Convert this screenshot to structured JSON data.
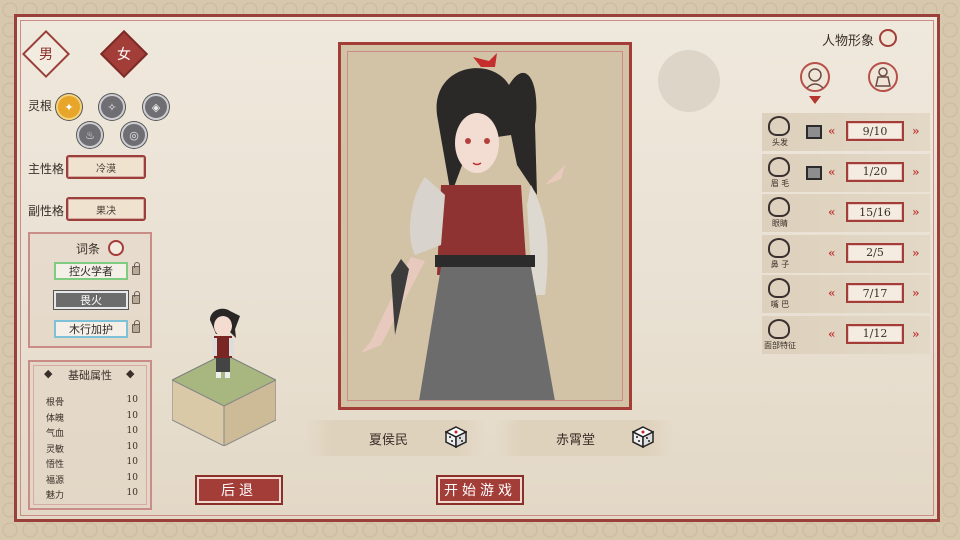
{
  "gender": {
    "male": "男",
    "female": "女",
    "selected": "female"
  },
  "spirit_root": {
    "label": "灵根",
    "roots": [
      {
        "icon": "water-element-icon",
        "active": true
      },
      {
        "icon": "wood-element-icon",
        "active": false
      },
      {
        "icon": "metal-element-icon",
        "active": false
      },
      {
        "icon": "fire-element-icon",
        "active": false
      },
      {
        "icon": "earth-element-icon",
        "active": false
      }
    ]
  },
  "personality": {
    "main_label": "主性格",
    "main_value": "冷漠",
    "sub_label": "副性格",
    "sub_value": "果决"
  },
  "traits": {
    "title": "词条",
    "items": [
      "控火学者",
      "畏火",
      "木行加护"
    ]
  },
  "attributes": {
    "title": "基础属性",
    "rows": [
      {
        "name": "根骨",
        "value": "10"
      },
      {
        "name": "体魄",
        "value": "10"
      },
      {
        "name": "气血",
        "value": "10"
      },
      {
        "name": "灵敏",
        "value": "10"
      },
      {
        "name": "悟性",
        "value": "10"
      },
      {
        "name": "福源",
        "value": "10"
      },
      {
        "name": "魅力",
        "value": "10"
      }
    ]
  },
  "names": {
    "surname": "夏侯民",
    "given": "赤霄堂"
  },
  "buttons": {
    "back": "后退",
    "start": "开始游戏"
  },
  "appearance": {
    "title": "人物形象",
    "features": [
      {
        "label": "头发",
        "value": "9/10",
        "has_color": true
      },
      {
        "label": "眉 毛",
        "value": "1/20",
        "has_color": true
      },
      {
        "label": "眼睛",
        "value": "15/16",
        "has_color": false
      },
      {
        "label": "鼻 子",
        "value": "2/5",
        "has_color": false
      },
      {
        "label": "嘴 巴",
        "value": "7/17",
        "has_color": false
      },
      {
        "label": "面部特征",
        "value": "1/12",
        "has_color": false
      }
    ]
  },
  "colors": {
    "accent": "#a33d38",
    "paper": "#efe8dc"
  }
}
